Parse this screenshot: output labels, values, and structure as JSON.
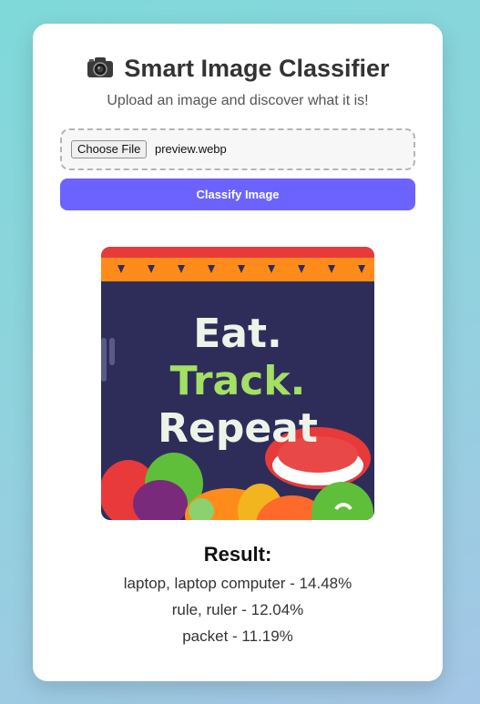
{
  "app": {
    "title": "Smart Image Classifier",
    "subtitle": "Upload an image and discover what it is!",
    "title_icon": "camera-icon"
  },
  "file_input": {
    "button_label": "Choose File",
    "file_name": "preview.webp"
  },
  "classify_button": {
    "label": "Classify Image"
  },
  "preview_image": {
    "lines": [
      "Eat.",
      "Track.",
      "Repeat"
    ]
  },
  "result": {
    "heading": "Result:",
    "predictions": [
      "laptop, laptop computer - 14.48%",
      "rule, ruler - 12.04%",
      "packet - 11.19%"
    ]
  },
  "colors": {
    "accent": "#6c63ff",
    "preview_background": "#2e2d5a",
    "preview_track_text": "#a4e063",
    "preview_banner_red": "#e83a3a",
    "preview_banner_orange": "#ff8c1a"
  }
}
